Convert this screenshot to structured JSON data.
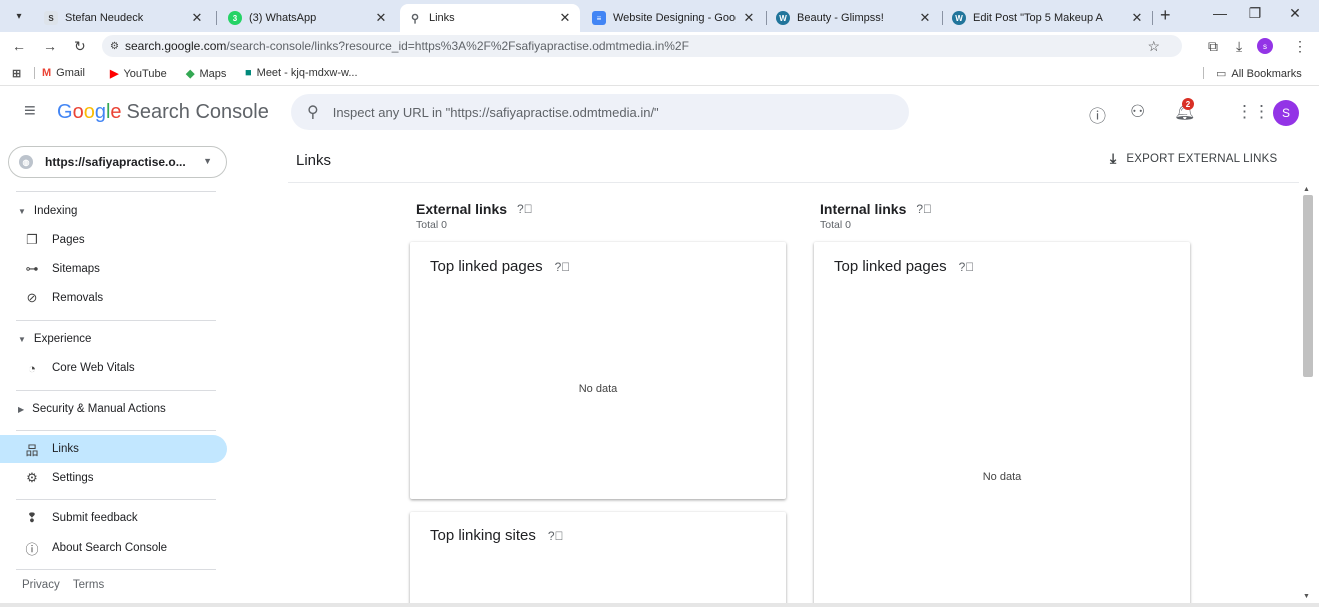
{
  "browser": {
    "tabs": [
      {
        "title": "Stefan Neudeck",
        "favicon": "sn-favicon",
        "color": "#5f6368"
      },
      {
        "title": "(3) WhatsApp",
        "favicon": "whatsapp-icon",
        "color": "#25d366"
      },
      {
        "title": "Links",
        "favicon": "search-console-icon",
        "color": "#ffffff",
        "active": true
      },
      {
        "title": "Website Designing - Googl",
        "favicon": "docs-icon",
        "color": "#4285f4"
      },
      {
        "title": "Beauty - Glimpss!",
        "favicon": "wordpress-icon",
        "color": "#21759b"
      },
      {
        "title": "Edit Post \"Top 5 Makeup A",
        "favicon": "wordpress-icon",
        "color": "#21759b"
      }
    ],
    "address_host": "search.google.com",
    "address_path": "/search-console/links?resource_id=https%3A%2F%2Fsafiyapractise.odmtmedia.in%2F",
    "profile_initial": "s",
    "bookmarks": [
      {
        "label": "Gmail"
      },
      {
        "label": "YouTube"
      },
      {
        "label": "Maps"
      },
      {
        "label": "Meet - kjq-mdxw-w..."
      }
    ],
    "all_bookmarks": "All Bookmarks"
  },
  "header": {
    "logo_google": "Google",
    "logo_rest": "Search Console",
    "search_placeholder": "Inspect any URL in \"https://safiyapractise.odmtmedia.in/\"",
    "notification_count": "2",
    "avatar_initial": "S"
  },
  "sidebar": {
    "property": "https://safiyapractise.o...",
    "sections": {
      "indexing": "Indexing",
      "experience": "Experience",
      "security": "Security & Manual Actions"
    },
    "items": {
      "pages": "Pages",
      "sitemaps": "Sitemaps",
      "removals": "Removals",
      "core_web_vitals": "Core Web Vitals",
      "links": "Links",
      "settings": "Settings",
      "submit_feedback": "Submit feedback",
      "about": "About Search Console"
    },
    "footer": {
      "privacy": "Privacy",
      "terms": "Terms"
    }
  },
  "main": {
    "title": "Links",
    "export_label": "EXPORT EXTERNAL LINKS",
    "external": {
      "heading": "External links",
      "total": "Total 0",
      "top_linked_pages": {
        "title": "Top linked pages",
        "empty": "No data"
      },
      "top_linking_sites": {
        "title": "Top linking sites"
      }
    },
    "internal": {
      "heading": "Internal links",
      "total": "Total 0",
      "top_linked_pages": {
        "title": "Top linked pages",
        "empty": "No data"
      }
    }
  },
  "colors": {
    "accent": "#1a73e8",
    "active_nav": "#c2e7ff",
    "avatar": "#9334e6",
    "badge": "#d93025"
  }
}
